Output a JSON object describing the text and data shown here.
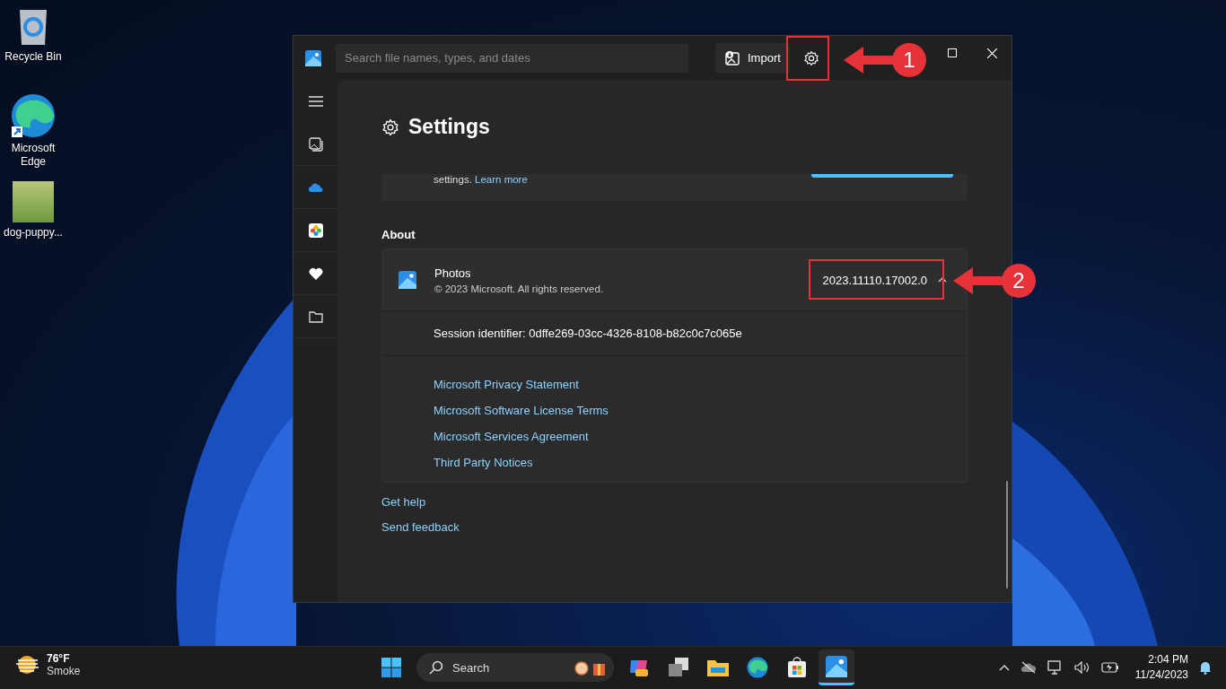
{
  "desktop_icons": [
    {
      "label": "Recycle Bin",
      "kind": "recycle"
    },
    {
      "label": "Microsoft Edge",
      "kind": "edge"
    },
    {
      "label": "dog-puppy...",
      "kind": "photo"
    }
  ],
  "window": {
    "search": {
      "placeholder": "Search file names, types, and dates"
    },
    "import_button": "Import"
  },
  "settings": {
    "title": "Settings",
    "partial_card_text": "settings.",
    "learn_more": "Learn more",
    "about_heading": "About",
    "app": {
      "name": "Photos",
      "copyright": "© 2023 Microsoft. All rights reserved.",
      "version": "2023.11110.17002.0",
      "expanded": true
    },
    "session": "Session identifier: 0dffe269-03cc-4326-8108-b82c0c7c065e",
    "links": [
      "Microsoft Privacy Statement",
      "Microsoft Software License Terms",
      "Microsoft Services Agreement",
      "Third Party Notices"
    ],
    "footer_links": [
      "Get help",
      "Send feedback"
    ]
  },
  "annotations": [
    {
      "number": "1"
    },
    {
      "number": "2"
    }
  ],
  "taskbar": {
    "weather": {
      "temperature": "76°F",
      "condition": "Smoke"
    },
    "search": "Search",
    "time": "2:04 PM",
    "date": "11/24/2023"
  }
}
